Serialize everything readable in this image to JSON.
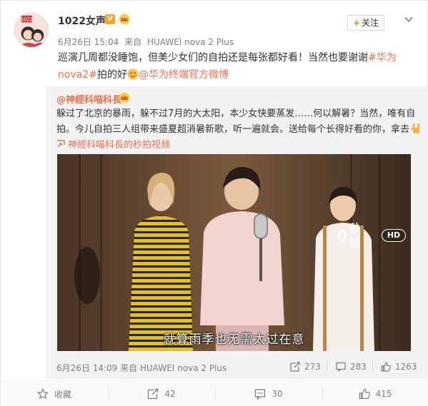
{
  "post": {
    "username": "1022女声",
    "verified_badge": "V",
    "time": "6月26日 15:04",
    "source_prefix": "来自",
    "source": "HUAWEI nova 2 Plus",
    "follow_label": "关注",
    "text_1": "巡演几周都没睡饱，但美少女们的自拍还是每张都好看！当然也要谢谢",
    "link_topic": "#华为nova2#",
    "text_2": "拍的好",
    "link_mention": "@华为终端官方微博"
  },
  "repost": {
    "username": "@神經科喵科長",
    "text": "躲过了北京的暴雨，躲不过7月的大太阳，本少女快要蒸发……何以解暑？当然，唯有自拍。今儿自拍三人组带来盛夏超消暑新歌，听一遍就会。送给每个长得好看的你，拿去",
    "video_link": "神經科喵科長的秒拍视频",
    "video": {
      "watermark": "秒拍",
      "hd_label": "HD",
      "subtitle": "就算雨季也无需太过在意"
    },
    "time": "6月26日 14:09",
    "source_prefix": "来自",
    "source": "HUAWEI nova 2 Plus",
    "stats": {
      "reposts": "273",
      "comments": "283",
      "likes": "1263"
    }
  },
  "footer": {
    "favorite_label": "收藏",
    "repost_count": "42",
    "comment_count": "30",
    "like_count": "415"
  },
  "colors": {
    "link": "#eb7350",
    "meta": "#808080",
    "follow_plus": "#ff8200"
  },
  "icons": [
    "chevron-down-icon",
    "crown-icon",
    "emoji-icon",
    "rock-hand-emoji",
    "video-link-icon",
    "repost-icon",
    "comment-icon",
    "like-icon",
    "star-icon"
  ]
}
